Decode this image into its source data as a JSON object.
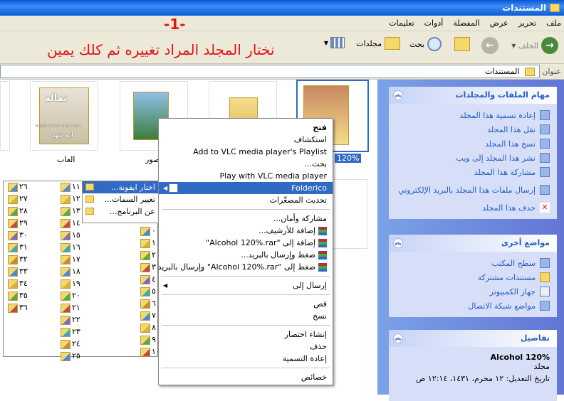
{
  "window": {
    "title": "المستندات"
  },
  "menu": [
    "ملف",
    "تحرير",
    "عرض",
    "المفضلة",
    "أدوات",
    "تعليمات"
  ],
  "toolbar": {
    "back": "الخلف",
    "search": "بحث",
    "folders": "مجلدات"
  },
  "annotation": {
    "step": "-1-",
    "instruction": "نختار المجلد المراد تغييره ثم كلك يمين"
  },
  "address": {
    "label": "عنوان",
    "value": "المستندات"
  },
  "content": {
    "folder_games": "العاب",
    "folder_pictures": "صور",
    "selected_caption": "120%",
    "watermark_top": "ثمالة",
    "watermark_site": "www.thomala.com",
    "watermark_name": "أبو عهد"
  },
  "context_menu": {
    "items": [
      "فتح",
      "استكشاف",
      "Add to VLC media player's Playlist",
      "بحث...",
      "Play with VLC media player",
      "Folderico",
      "تحديث المصغّرات",
      "مشاركة وأمان...",
      "إضافة للأرشيف...",
      "إضافة إلى \"Alcohol 120%.rar\"",
      "ضغط وإرسال بالبريد...",
      "ضغط إلى \"Alcohol 120%.rar\" وإرسال بالبريد",
      "إرسال إلى",
      "قص",
      "نسخ",
      "إنشاء اختصار",
      "حذف",
      "إعادة التسمية",
      "خصائص"
    ]
  },
  "submenu": [
    "اختار ايقونة...",
    "تغيير السمات...",
    "عن البرنامج..."
  ],
  "grid": {
    "col1": [
      "١١",
      "١٢",
      "١٣",
      "١٤",
      "١٥",
      "١٦",
      "١٧",
      "١٨",
      "١٩",
      "٢٠",
      "٢١",
      "٢٢",
      "٢٣",
      "٢٤",
      "٢٥"
    ],
    "col2": [
      "٢٦",
      "٢٧",
      "٢٨",
      "٢٩",
      "٣٠",
      "٣١",
      "٣٢",
      "٣٣",
      "٣٤",
      "٣٥",
      "٣٦"
    ],
    "col0": [
      "٠",
      "١",
      "٢",
      "٣",
      "٤",
      "٥",
      "٦",
      "٧",
      "٨",
      "٩",
      "١٠"
    ]
  },
  "tasks": {
    "folder_tasks": {
      "title": "مهام الملفات والمجلدات",
      "items": [
        "إعادة تسمية هذا المجلد",
        "نقل هذا المجلد",
        "نسخ هذا المجلد",
        "نشر هذا المجلد إلى ويب",
        "مشاركة هذا المجلد",
        "إرسال ملفات هذا المجلد بالبريد الإلكتروني",
        "حذف هذا المجلد"
      ]
    },
    "other_places": {
      "title": "مواضع أخرى",
      "items": [
        "سطح المكتب",
        "مستندات مشتركة",
        "جهاز الكمبيوتر",
        "مواضع شبكة الاتصال"
      ]
    },
    "details": {
      "title": "تفاصيل",
      "name": "Alcohol 120%",
      "type": "مجلد",
      "modified": "تاريخ التعديل: ١٢ محرم، ١٤٣١، ١٢:١٤ ص"
    }
  }
}
